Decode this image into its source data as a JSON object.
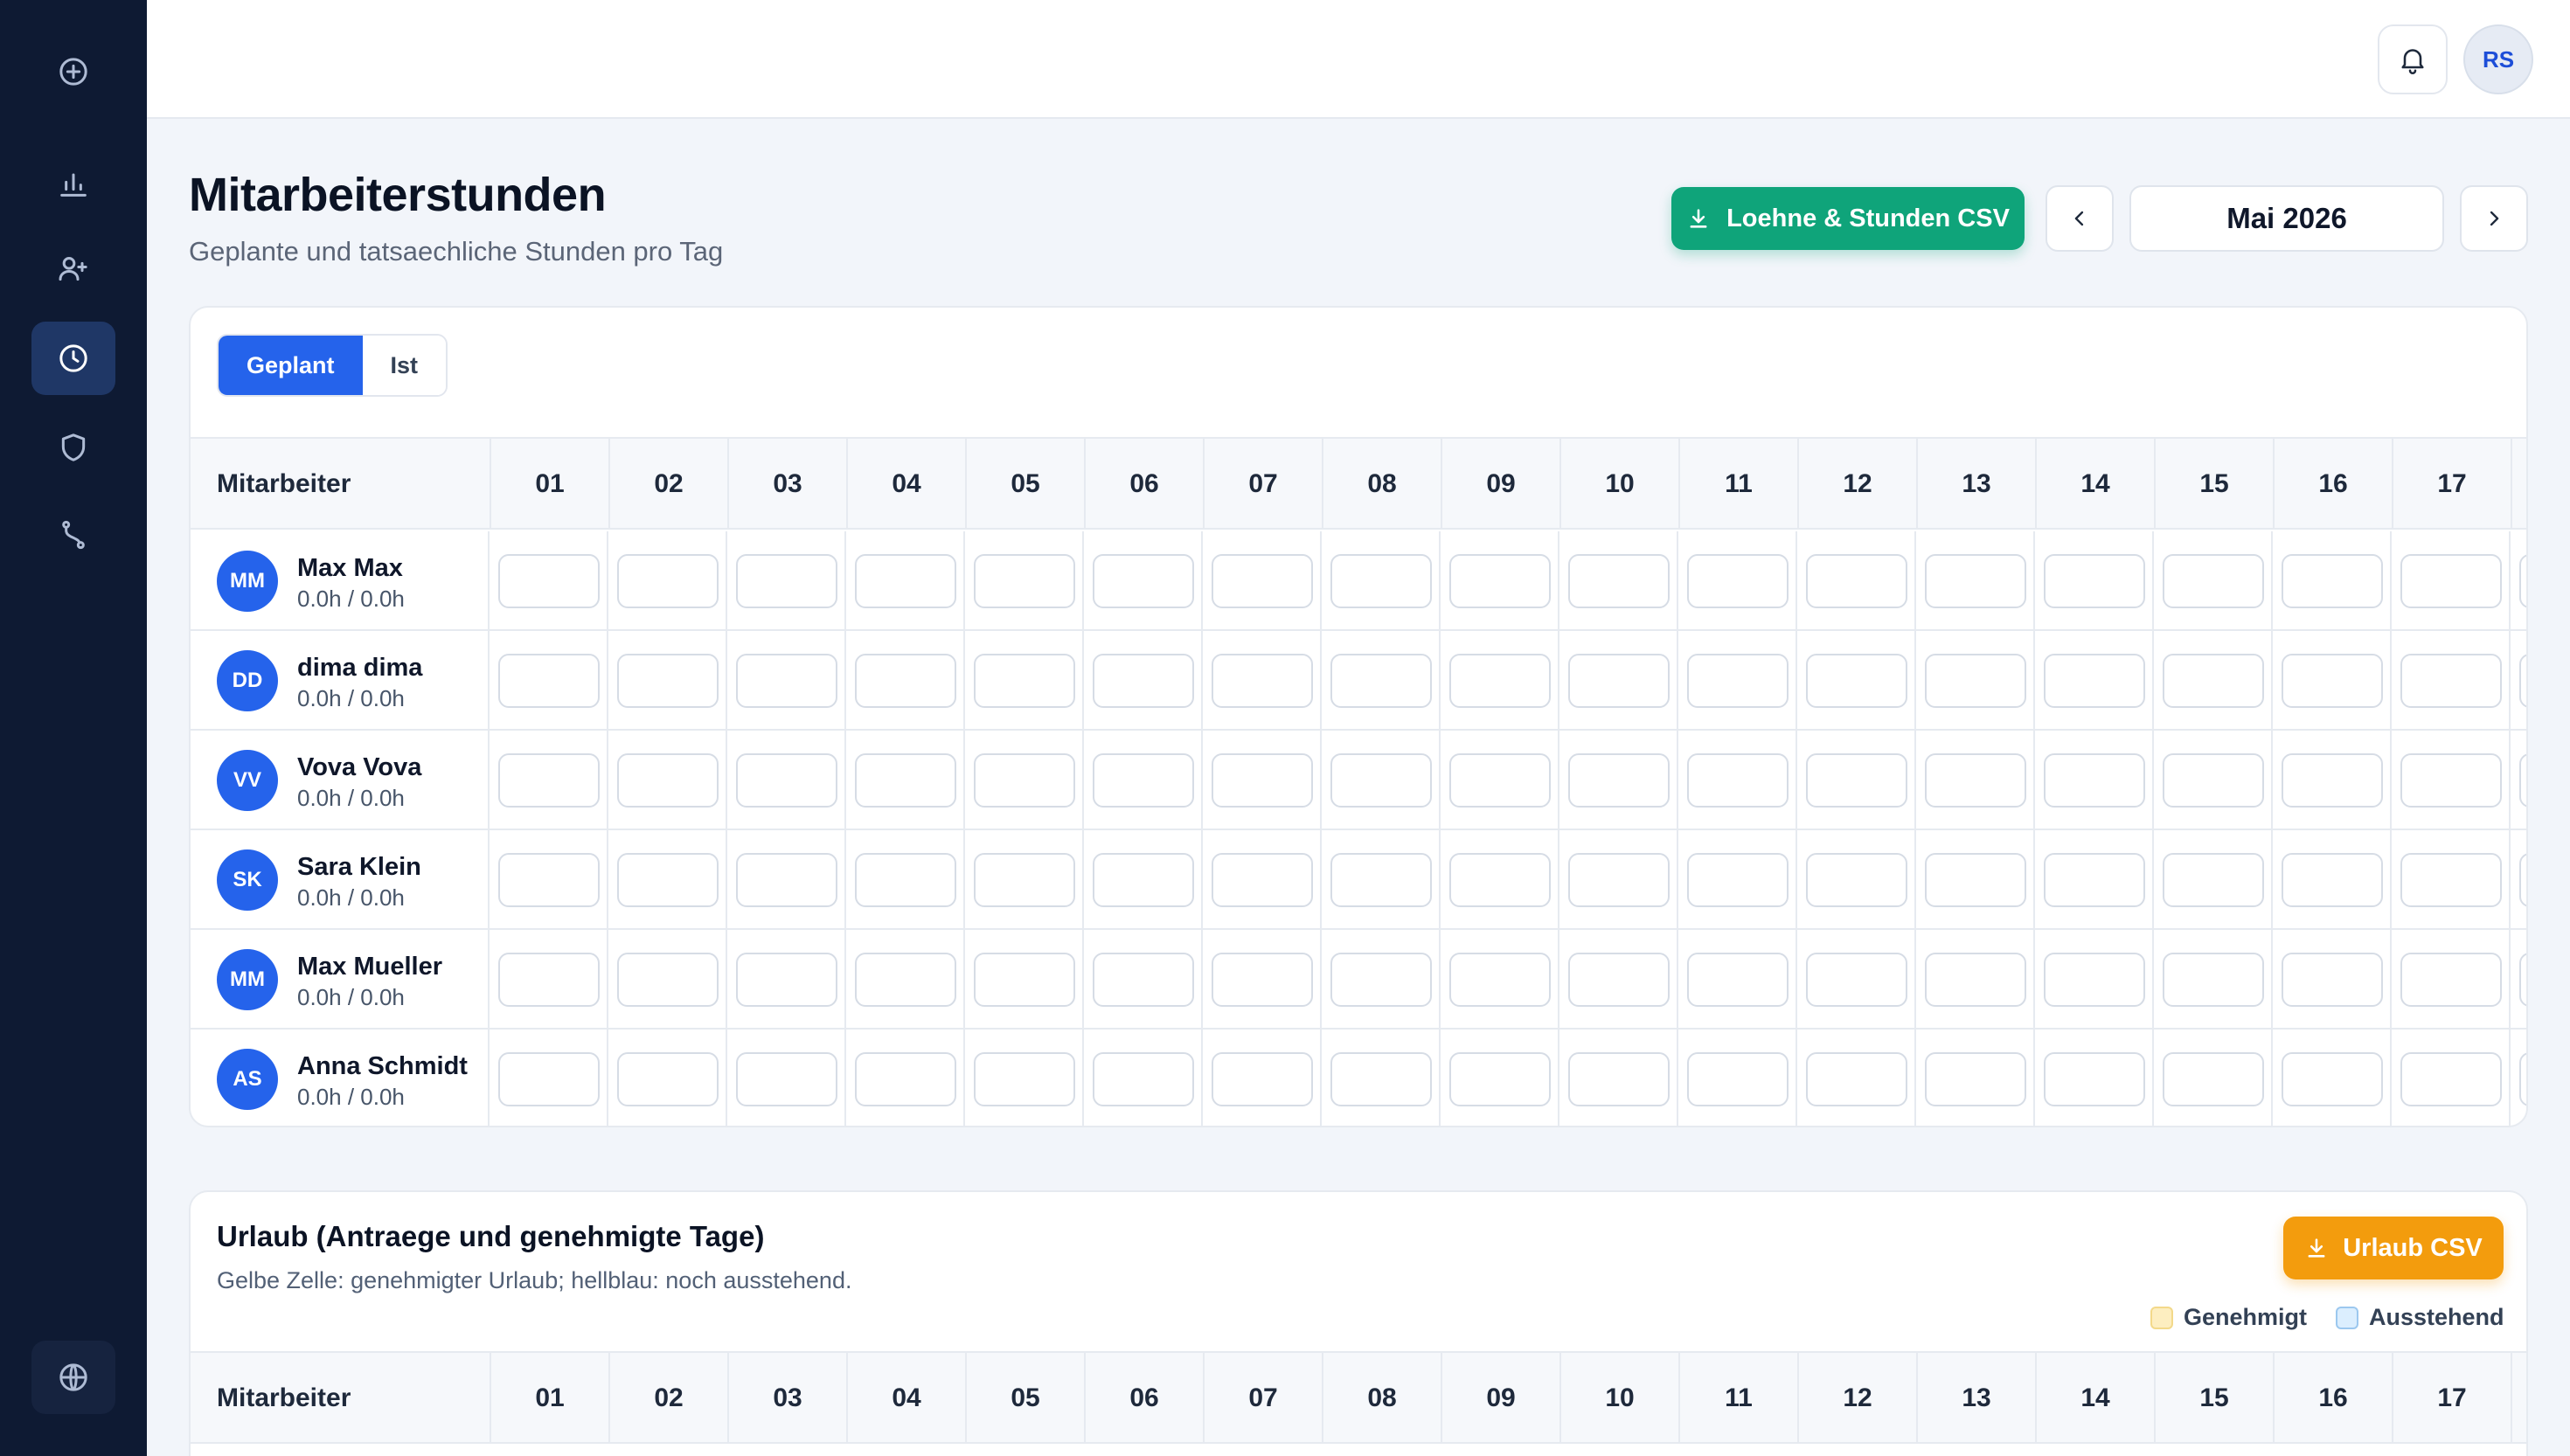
{
  "sidebar": {
    "items": [
      {
        "icon": "plus-circle-icon"
      },
      {
        "icon": "bar-chart-icon"
      },
      {
        "icon": "user-plus-icon"
      },
      {
        "icon": "clock-icon"
      },
      {
        "icon": "shield-icon"
      },
      {
        "icon": "route-icon"
      }
    ],
    "bottom_icon": "globe-icon",
    "active_index": 3
  },
  "topbar": {
    "notification_icon": "bell-icon",
    "user_initials": "RS"
  },
  "header": {
    "title": "Mitarbeiterstunden",
    "subtitle": "Geplante und tatsaechliche Stunden pro Tag",
    "csv_button": "Loehne & Stunden CSV",
    "month": "Mai 2026"
  },
  "hours_card": {
    "tabs": [
      "Geplant",
      "Ist"
    ],
    "active_tab": "Geplant",
    "name_column": "Mitarbeiter",
    "days": [
      "01",
      "02",
      "03",
      "04",
      "05",
      "06",
      "07",
      "08",
      "09",
      "10",
      "11",
      "12",
      "13",
      "14",
      "15",
      "16",
      "17"
    ],
    "employees": [
      {
        "initials": "MM",
        "name": "Max Max",
        "hours": "0.0h / 0.0h"
      },
      {
        "initials": "DD",
        "name": "dima dima",
        "hours": "0.0h / 0.0h"
      },
      {
        "initials": "VV",
        "name": "Vova Vova",
        "hours": "0.0h / 0.0h"
      },
      {
        "initials": "SK",
        "name": "Sara Klein",
        "hours": "0.0h / 0.0h"
      },
      {
        "initials": "MM",
        "name": "Max Mueller",
        "hours": "0.0h / 0.0h"
      },
      {
        "initials": "AS",
        "name": "Anna Schmidt",
        "hours": "0.0h / 0.0h"
      }
    ]
  },
  "vacation_card": {
    "title": "Urlaub (Antraege und genehmigte Tage)",
    "subtitle": "Gelbe Zelle: genehmigter Urlaub; hellblau: noch ausstehend.",
    "csv_button": "Urlaub CSV",
    "legend": [
      {
        "label": "Genehmigt",
        "color": "#fdeec0"
      },
      {
        "label": "Ausstehend",
        "color": "#dbeefe"
      }
    ],
    "name_column": "Mitarbeiter",
    "days": [
      "01",
      "02",
      "03",
      "04",
      "05",
      "06",
      "07",
      "08",
      "09",
      "10",
      "11",
      "12",
      "13",
      "14",
      "15",
      "16",
      "17"
    ]
  },
  "colors": {
    "sidebar": "#0e1a33",
    "primary": "#2563eb",
    "green": "#0fa47a",
    "orange": "#f39c0d"
  }
}
